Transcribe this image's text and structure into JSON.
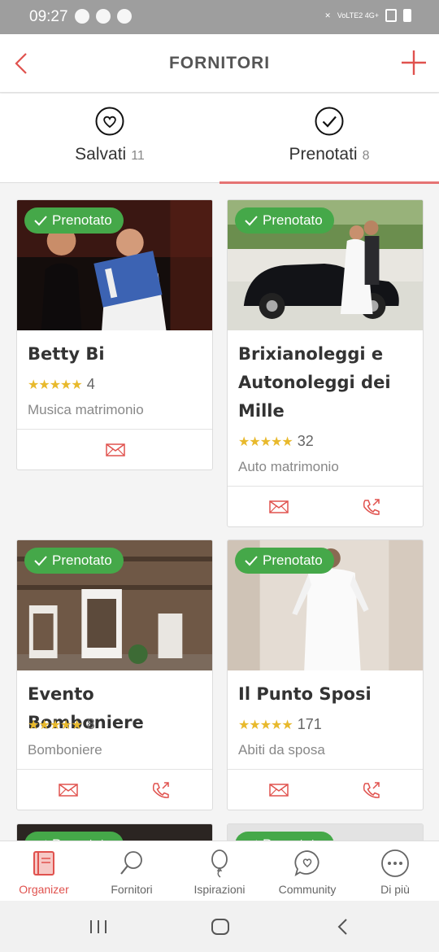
{
  "status": {
    "time": "09:27",
    "network": "VoLTE2 4G+"
  },
  "header": {
    "title": "FORNITORI"
  },
  "tabs": [
    {
      "label": "Salvati",
      "count": "11"
    },
    {
      "label": "Prenotati",
      "count": "8"
    }
  ],
  "badge_label": "Prenotato",
  "cards": [
    {
      "name": "Betty Bi",
      "rating_count": "4",
      "category": "Musica matrimonio",
      "stars": "★★★★★"
    },
    {
      "name": "Brixianoleggi e Autonoleggi dei Mille",
      "rating_count": "32",
      "category": "Auto matrimonio",
      "stars": "★★★★★"
    },
    {
      "name": "Evento Bomboniere",
      "rating_count": "8",
      "category": "Bomboniere",
      "stars": "★★★★★"
    },
    {
      "name": "Il Punto Sposi",
      "rating_count": "171",
      "category": "Abiti da sposa",
      "stars": "★★★★★"
    }
  ],
  "nav": [
    {
      "label": "Organizer"
    },
    {
      "label": "Fornitori"
    },
    {
      "label": "Ispirazioni"
    },
    {
      "label": "Community"
    },
    {
      "label": "Di più"
    }
  ],
  "colors": {
    "accent": "#e0524e",
    "badge": "#45a849",
    "star": "#e8b92c"
  }
}
